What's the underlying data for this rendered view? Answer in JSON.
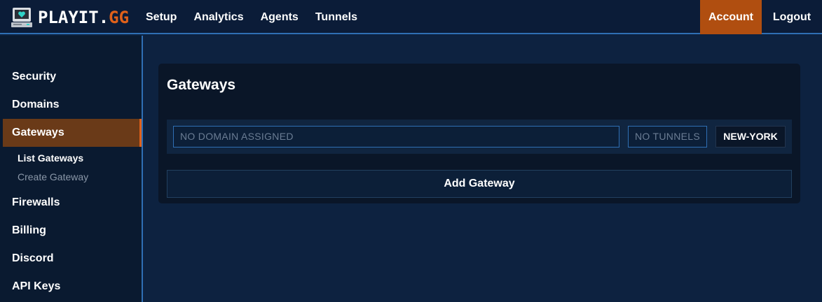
{
  "brand": {
    "logo_icon": "computer-heart-icon",
    "name_main": "PLAYIT.",
    "name_accent": "GG"
  },
  "nav": {
    "items": [
      {
        "label": "Setup"
      },
      {
        "label": "Analytics"
      },
      {
        "label": "Agents"
      },
      {
        "label": "Tunnels"
      }
    ],
    "account_label": "Account",
    "logout_label": "Logout"
  },
  "sidebar": {
    "items": [
      {
        "label": "Security"
      },
      {
        "label": "Domains"
      },
      {
        "label": "Gateways",
        "active": true
      },
      {
        "label": "Firewalls"
      },
      {
        "label": "Billing"
      },
      {
        "label": "Discord"
      },
      {
        "label": "API Keys"
      }
    ],
    "gateways_sub": [
      {
        "label": "List Gateways",
        "current": true
      },
      {
        "label": "Create Gateway"
      }
    ]
  },
  "main": {
    "title": "Gateways",
    "gateways": [
      {
        "domain": "NO DOMAIN ASSIGNED",
        "tunnels": "NO TUNNELS",
        "region": "NEW-YORK"
      }
    ],
    "add_button_label": "Add Gateway"
  },
  "colors": {
    "accent": "#e0611a",
    "accent_dark": "#b04e10",
    "background": "#0d2240",
    "border_blue": "#2f6fb4"
  }
}
